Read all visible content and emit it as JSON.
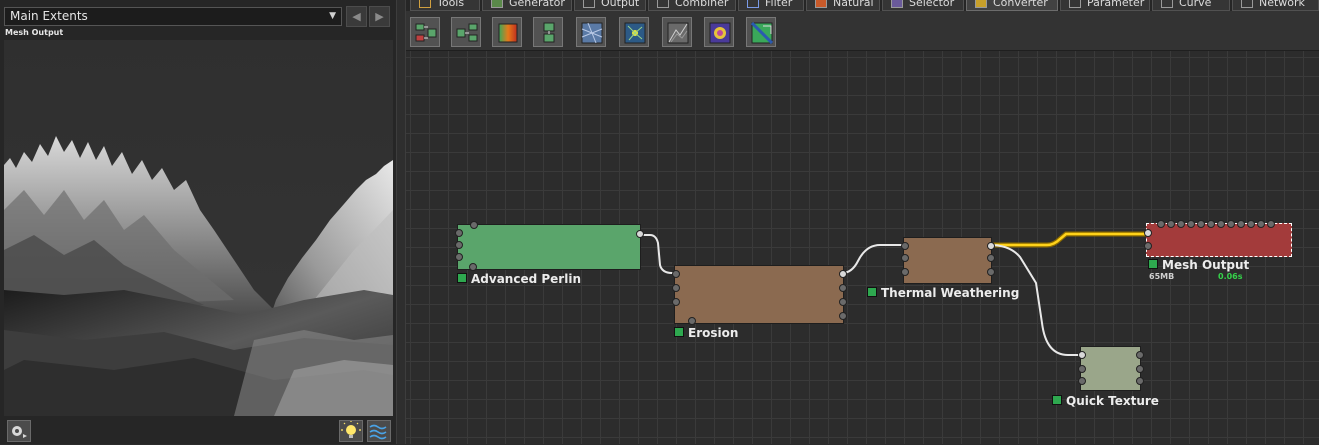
{
  "preview": {
    "extents_value": "Main Extents",
    "title": "Mesh Output"
  },
  "tabs": [
    {
      "label": "Tools",
      "icon": "tools-icon"
    },
    {
      "label": "Generator",
      "icon": "generator-icon"
    },
    {
      "label": "Output",
      "icon": "output-icon"
    },
    {
      "label": "Combiner",
      "icon": "combiner-icon"
    },
    {
      "label": "Filter",
      "icon": "filter-icon"
    },
    {
      "label": "Natural",
      "icon": "natural-icon"
    },
    {
      "label": "Selector",
      "icon": "selector-icon"
    },
    {
      "label": "Converter",
      "icon": "converter-icon",
      "active": true
    },
    {
      "label": "Parameter",
      "icon": "parameter-icon"
    },
    {
      "label": "Curve",
      "icon": "curve-icon"
    },
    {
      "label": "Network",
      "icon": "network-icon"
    }
  ],
  "nodes": {
    "advanced_perlin": {
      "label": "Advanced Perlin",
      "color": "#5aa56b"
    },
    "erosion": {
      "label": "Erosion",
      "color": "#8b6a50"
    },
    "thermal_weathering": {
      "label": "Thermal Weathering",
      "color": "#8b6a50"
    },
    "mesh_output": {
      "label": "Mesh Output",
      "color": "#a33b3b",
      "memory": "65MB",
      "time": "0.06s"
    },
    "quick_texture": {
      "label": "Quick Texture",
      "color": "#9aa68a"
    }
  },
  "colors": {
    "accent_selected_wire": "#e6b800",
    "status_square": "#2ea84f",
    "time_text": "#35d24a"
  }
}
